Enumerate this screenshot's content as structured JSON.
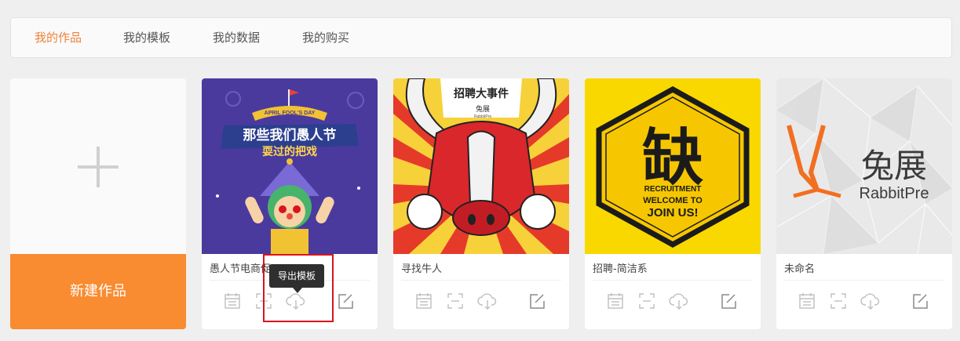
{
  "tabs": [
    {
      "label": "我的作品",
      "active": true
    },
    {
      "label": "我的模板",
      "active": false
    },
    {
      "label": "我的数据",
      "active": false
    },
    {
      "label": "我的购买",
      "active": false
    }
  ],
  "new_work": {
    "label": "新建作品",
    "icon": "plus-icon"
  },
  "works": [
    {
      "title": "愚人节电商促",
      "thumb_text": {
        "banner": "APRIL FOOL'S DAY",
        "line1": "那些我们愚人节",
        "line2": "耍过的把戏"
      }
    },
    {
      "title": "寻找牛人",
      "thumb_text": {
        "headline": "招聘大事件",
        "brand": "兔展",
        "brand_en": "RabbitPre"
      }
    },
    {
      "title": "招聘-简洁系",
      "thumb_text": {
        "big": "缺",
        "line1": "RECRUITMENT",
        "line2": "WELCOME TO",
        "line3": "JOIN US!"
      }
    },
    {
      "title": "未命名",
      "thumb_text": {
        "brand": "兔展",
        "brand_en": "RabbitPre"
      }
    }
  ],
  "card_actions": [
    "calendar-icon",
    "qr-scan-icon",
    "cloud-download-icon",
    "edit-icon"
  ],
  "tooltip": {
    "text": "导出模板"
  },
  "colors": {
    "accent": "#f0823a",
    "new_button": "#f98b30",
    "highlight": "#d9141e"
  }
}
